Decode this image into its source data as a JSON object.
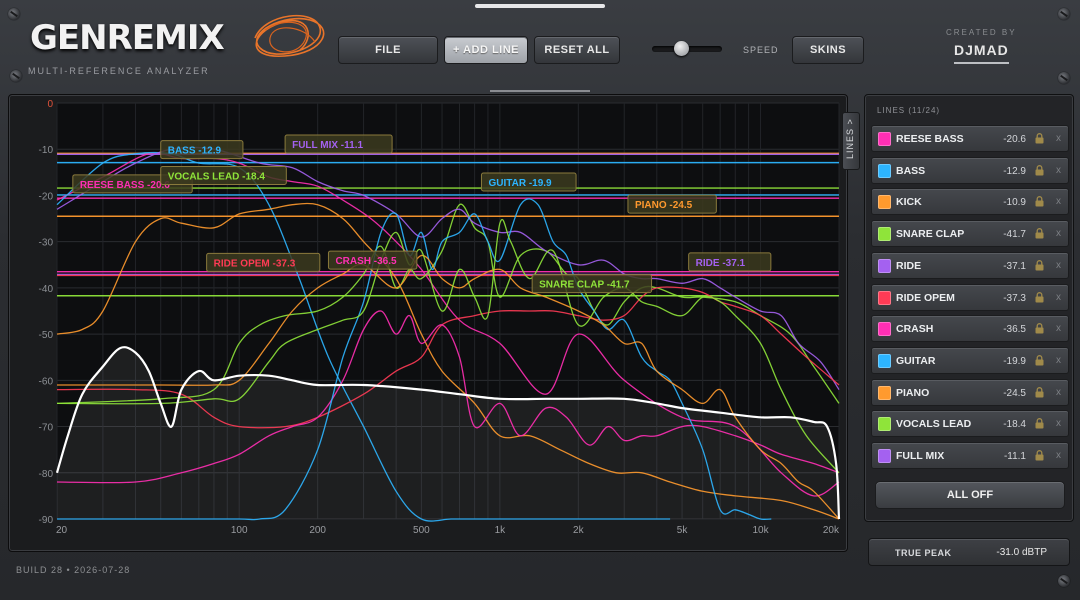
{
  "header": {
    "logo": "GENREMIX",
    "subtitle": "MULTI-REFERENCE ANALYZER",
    "buttons": {
      "file": "FILE",
      "add_line": "+ ADD LINE",
      "reset_all": "RESET ALL",
      "skins": "SKINS"
    },
    "speed_label": "SPEED",
    "speed_value": 0.4,
    "created_by": "CREATED BY",
    "author": "DJMAD"
  },
  "graph": {
    "lines_tab": "LINES >",
    "y_ticks": [
      "0",
      "-10",
      "-20",
      "-30",
      "-40",
      "-50",
      "-60",
      "-70",
      "-80",
      "-90"
    ],
    "x_ticks": [
      "20",
      "100",
      "200",
      "500",
      "1k",
      "2k",
      "5k",
      "10k",
      "20k"
    ]
  },
  "chart_data": {
    "type": "line",
    "xlabel": "",
    "ylabel": "",
    "x_scale": "log",
    "xlim": [
      20,
      20000
    ],
    "ylim": [
      -90,
      0
    ],
    "grid": true,
    "references": [
      {
        "name": "REESE BASS",
        "level": -20.6,
        "color": "#ff2fb4"
      },
      {
        "name": "BASS",
        "level": -12.9,
        "color": "#2db5ff"
      },
      {
        "name": "KICK",
        "level": -10.9,
        "color": "#ff9a2e"
      },
      {
        "name": "SNARE CLAP",
        "level": -41.7,
        "color": "#8fe43a"
      },
      {
        "name": "RIDE",
        "level": -37.1,
        "color": "#a461f0"
      },
      {
        "name": "RIDE OPEM",
        "level": -37.3,
        "color": "#ff3b55"
      },
      {
        "name": "CRASH",
        "level": -36.5,
        "color": "#ff2fb4"
      },
      {
        "name": "GUITAR",
        "level": -19.9,
        "color": "#2db5ff"
      },
      {
        "name": "PIANO",
        "level": -24.5,
        "color": "#ff9a2e"
      },
      {
        "name": "VOCALS LEAD",
        "level": -18.4,
        "color": "#8fe43a"
      },
      {
        "name": "FULL MIX",
        "level": -11.1,
        "color": "#a461f0"
      }
    ],
    "labels": [
      {
        "text": "BASS  -12.9",
        "color": "#2db5ff",
        "freq": 50,
        "level": -10.3
      },
      {
        "text": "FULL MIX  -11.1",
        "color": "#a461f0",
        "freq": 150,
        "level": -9.1
      },
      {
        "text": "REESE BASS  -20.6",
        "color": "#ff2fb4",
        "freq": 23,
        "level": -17.7
      },
      {
        "text": "VOCALS LEAD  -18.4",
        "color": "#8fe43a",
        "freq": 50,
        "level": -15.9
      },
      {
        "text": "GUITAR  -19.9",
        "color": "#2db5ff",
        "freq": 850,
        "level": -17.3
      },
      {
        "text": "PIANO  -24.5",
        "color": "#ff9a2e",
        "freq": 3100,
        "level": -22.1
      },
      {
        "text": "RIDE OPEM  -37.3",
        "color": "#ff3b55",
        "freq": 75,
        "level": -34.7
      },
      {
        "text": "CRASH  -36.5",
        "color": "#ff2fb4",
        "freq": 220,
        "level": -34.2
      },
      {
        "text": "SNARE CLAP  -41.7",
        "color": "#8fe43a",
        "freq": 1330,
        "level": -39.3
      },
      {
        "text": "RIDE  -37.1",
        "color": "#a461f0",
        "freq": 5300,
        "level": -34.6
      }
    ],
    "series": [
      {
        "name": "REESE BASS",
        "color": "#ff2fb4",
        "x": [
          20,
          30,
          45,
          60,
          80,
          100,
          130,
          160,
          200,
          250,
          320,
          400,
          500,
          700,
          1000,
          1500,
          2000,
          3000,
          5000,
          8000,
          12000,
          16000,
          20000
        ],
        "y": [
          -21,
          -16,
          -11,
          -12,
          -12,
          -13,
          -16,
          -17,
          -18,
          -21,
          -25,
          -30,
          -36,
          -47,
          -52,
          -63,
          -50,
          -60,
          -68,
          -70,
          -80,
          -85,
          -82
        ]
      },
      {
        "name": "BASS",
        "color": "#2db5ff",
        "x": [
          20,
          30,
          40,
          55,
          70,
          100,
          130,
          170,
          220,
          300,
          400,
          500,
          650,
          800,
          1000,
          1300,
          1700,
          2200,
          2800,
          3500,
          4500
        ],
        "y": [
          -22,
          -13,
          -11,
          -11,
          -13,
          -14,
          -22,
          -38,
          -55,
          -70,
          -84,
          -90,
          -90,
          -90,
          -90,
          -90,
          -90,
          -90,
          -90,
          -90,
          -90
        ]
      },
      {
        "name": "KICK",
        "color": "#ff9a2e",
        "x": [
          20,
          25,
          30,
          40,
          50,
          60,
          80,
          100,
          130,
          160,
          200,
          250,
          300,
          400,
          500,
          600,
          800,
          1000,
          1300,
          1700,
          2200,
          2800,
          3500,
          4500,
          6000,
          8000,
          12000,
          16000,
          20000
        ],
        "y": [
          -50,
          -49,
          -45,
          -30,
          -25,
          -26,
          -27,
          -24,
          -23,
          -22,
          -22,
          -25,
          -30,
          -38,
          -50,
          -58,
          -65,
          -72,
          -72,
          -75,
          -78,
          -80,
          -80,
          -82,
          -84,
          -85,
          -86,
          -88,
          -90
        ]
      },
      {
        "name": "SNARE CLAP",
        "color": "#8fe43a",
        "x": [
          20,
          50,
          80,
          100,
          120,
          150,
          200,
          250,
          300,
          350,
          400,
          450,
          500,
          600,
          700,
          800,
          900,
          1000,
          1200,
          1500,
          1800,
          2000,
          2300,
          2600,
          3000,
          3500,
          4000,
          5000,
          6000,
          8000,
          10000,
          13000,
          16000,
          20000
        ],
        "y": [
          -65,
          -64,
          -62,
          -52,
          -48,
          -46,
          -45,
          -42,
          -37,
          -31,
          -40,
          -36,
          -38,
          -32,
          -22,
          -27,
          -30,
          -42,
          -33,
          -32,
          -37,
          -38,
          -45,
          -48,
          -43,
          -40,
          -40,
          -42,
          -42,
          -43,
          -46,
          -50,
          -57,
          -65
        ]
      },
      {
        "name": "RIDE",
        "color": "#a461f0",
        "x": [
          20,
          30,
          40,
          55,
          80,
          120,
          160,
          200,
          250,
          300,
          400,
          500,
          600,
          700,
          800,
          1000,
          1200,
          1500,
          2000,
          2500,
          3000,
          3500,
          4000,
          5000,
          6000,
          7000,
          8000,
          10000,
          12000,
          14000,
          17000,
          20000
        ],
        "y": [
          -23,
          -17,
          -13,
          -10,
          -10,
          -13,
          -14,
          -17,
          -19,
          -20,
          -24,
          -29,
          -25,
          -23,
          -26,
          -28,
          -28,
          -32,
          -35,
          -34,
          -37,
          -38,
          -38,
          -39,
          -38,
          -40,
          -42,
          -45,
          -46,
          -52,
          -56,
          -62
        ]
      },
      {
        "name": "RIDE OPEM",
        "color": "#ff3b55",
        "x": [
          20,
          40,
          60,
          80,
          100,
          150,
          200,
          300,
          400,
          500,
          600,
          800,
          1000,
          1300,
          1600,
          2000,
          2500,
          3000,
          3500,
          4000,
          5000,
          6000,
          7000,
          8000,
          10000,
          12000,
          15000,
          20000
        ],
        "y": [
          -62,
          -62,
          -63,
          -68,
          -70,
          -70,
          -68,
          -63,
          -58,
          -55,
          -48,
          -46,
          -45,
          -45,
          -45,
          -46,
          -47,
          -46,
          -42,
          -40,
          -40,
          -41,
          -43,
          -44,
          -46,
          -50,
          -55,
          -61
        ]
      },
      {
        "name": "CRASH",
        "color": "#ff2fb4",
        "x": [
          20,
          40,
          60,
          80,
          100,
          130,
          160,
          200,
          250,
          300,
          350,
          400,
          450,
          500,
          600,
          700,
          800,
          1000,
          1200,
          1500,
          1800,
          2200,
          2600,
          3000,
          3500,
          4000,
          5000,
          6000,
          8000,
          10000,
          12000,
          16000,
          20000
        ],
        "y": [
          -82,
          -82,
          -80,
          -78,
          -76,
          -72,
          -70,
          -68,
          -60,
          -49,
          -45,
          -50,
          -46,
          -52,
          -48,
          -55,
          -70,
          -65,
          -72,
          -66,
          -68,
          -74,
          -70,
          -73,
          -72,
          -72,
          -70,
          -70,
          -72,
          -74,
          -76,
          -78,
          -80
        ]
      },
      {
        "name": "GUITAR",
        "color": "#2db5ff",
        "x": [
          20,
          60,
          100,
          120,
          150,
          200,
          250,
          300,
          350,
          400,
          450,
          500,
          550,
          600,
          700,
          800,
          900,
          1000,
          1200,
          1400,
          1600,
          1800,
          2000,
          2300,
          2600,
          3000,
          3500,
          4000,
          4500,
          5000,
          6000,
          7000,
          8000,
          9000,
          10000,
          11000
        ],
        "y": [
          -90,
          -90,
          -90,
          -90,
          -88,
          -75,
          -55,
          -43,
          -28,
          -24,
          -33,
          -28,
          -36,
          -30,
          -28,
          -24,
          -30,
          -34,
          -22,
          -22,
          -30,
          -33,
          -40,
          -45,
          -49,
          -47,
          -55,
          -58,
          -60,
          -65,
          -75,
          -88,
          -88,
          -89,
          -90,
          -90
        ]
      },
      {
        "name": "PIANO",
        "color": "#ff9a2e",
        "x": [
          20,
          50,
          80,
          100,
          130,
          160,
          200,
          250,
          300,
          400,
          500,
          600,
          700,
          800,
          1000,
          1200,
          1500,
          2000,
          2500,
          3000,
          3500,
          4000,
          5000,
          6000,
          7000,
          8000,
          10000,
          12000,
          14000,
          16000,
          20000
        ],
        "y": [
          -61,
          -61,
          -61,
          -60,
          -52,
          -45,
          -40,
          -37,
          -35,
          -40,
          -33,
          -38,
          -40,
          -38,
          -36,
          -40,
          -42,
          -45,
          -48,
          -52,
          -52,
          -58,
          -62,
          -65,
          -62,
          -68,
          -75,
          -78,
          -82,
          -84,
          -90
        ]
      },
      {
        "name": "VOCALS LEAD",
        "color": "#8fe43a",
        "x": [
          20,
          50,
          80,
          100,
          130,
          150,
          200,
          250,
          300,
          350,
          400,
          450,
          500,
          600,
          700,
          800,
          900,
          1000,
          1100,
          1300,
          1600,
          2000,
          2500,
          3000,
          3500,
          4000,
          5000,
          6000,
          7000,
          8000,
          10000,
          12000,
          15000,
          20000
        ],
        "y": [
          -65,
          -65,
          -64,
          -64,
          -56,
          -52,
          -49,
          -47,
          -45,
          -34,
          -28,
          -35,
          -32,
          -45,
          -36,
          -42,
          -46,
          -26,
          -30,
          -38,
          -32,
          -48,
          -42,
          -40,
          -43,
          -44,
          -46,
          -42,
          -43,
          -46,
          -52,
          -62,
          -72,
          -80
        ]
      },
      {
        "name": "FULL MIX",
        "color": "#ffffff",
        "x": [
          20,
          22,
          25,
          30,
          35,
          40,
          45,
          50,
          55,
          60,
          70,
          80,
          100,
          130,
          160,
          200,
          300,
          500,
          700,
          1000,
          1500,
          2000,
          3000,
          4000,
          5000,
          7000,
          10000,
          13000,
          16000,
          18000,
          19500,
          20000
        ],
        "y": [
          -80,
          -72,
          -63,
          -57,
          -53,
          -54,
          -58,
          -65,
          -70,
          -62,
          -58,
          -60,
          -59,
          -59,
          -60,
          -61,
          -61,
          -62,
          -63,
          -64,
          -64,
          -64,
          -64,
          -65,
          -66,
          -67,
          -68,
          -68,
          -69,
          -70,
          -78,
          -90
        ]
      }
    ]
  },
  "panel": {
    "lines_count": "LINES (11/24)",
    "rows": [
      {
        "name": "REESE BASS",
        "value": "-20.6",
        "color": "#ff2fb4"
      },
      {
        "name": "BASS",
        "value": "-12.9",
        "color": "#2db5ff"
      },
      {
        "name": "KICK",
        "value": "-10.9",
        "color": "#ff9a2e"
      },
      {
        "name": "SNARE CLAP",
        "value": "-41.7",
        "color": "#8fe43a"
      },
      {
        "name": "RIDE",
        "value": "-37.1",
        "color": "#a461f0"
      },
      {
        "name": "RIDE OPEM",
        "value": "-37.3",
        "color": "#ff3b55"
      },
      {
        "name": "CRASH",
        "value": "-36.5",
        "color": "#ff2fb4"
      },
      {
        "name": "GUITAR",
        "value": "-19.9",
        "color": "#2db5ff"
      },
      {
        "name": "PIANO",
        "value": "-24.5",
        "color": "#ff9a2e"
      },
      {
        "name": "VOCALS LEAD",
        "value": "-18.4",
        "color": "#8fe43a"
      },
      {
        "name": "FULL MIX",
        "value": "-11.1",
        "color": "#a461f0"
      }
    ],
    "remove_glyph": "x",
    "all_off": "ALL OFF"
  },
  "footer": {
    "true_peak_label": "TRUE PEAK",
    "true_peak_value": "-31.0 dBTP",
    "build": "BUILD 28  •  2026-07-28"
  }
}
